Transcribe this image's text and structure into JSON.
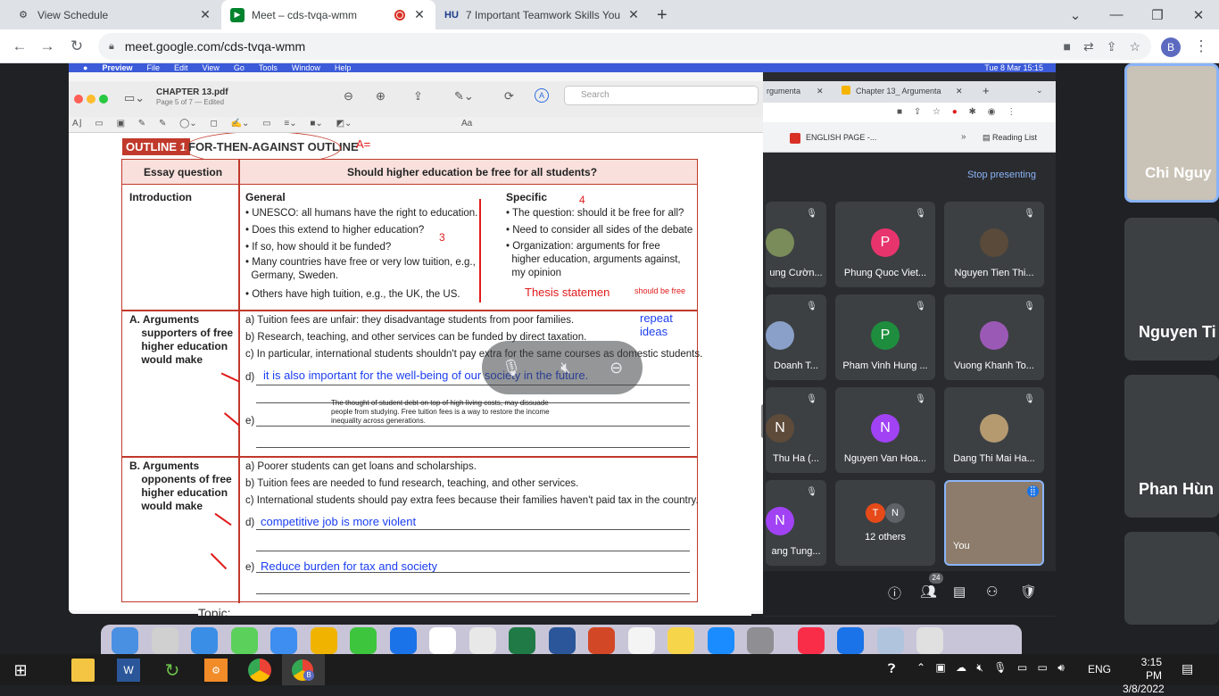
{
  "chrome": {
    "tabs": [
      {
        "title": "View Schedule",
        "icon": "schedule-icon",
        "active": false
      },
      {
        "title": "Meet – cds-tvqa-wmm",
        "icon": "meet-icon",
        "active": true,
        "recording": true
      },
      {
        "title": "7 Important Teamwork Skills You",
        "icon": "hu-icon",
        "icon_text": "HU",
        "active": false
      }
    ],
    "url": "meet.google.com/cds-tvqa-wmm",
    "profile_initial": "B"
  },
  "mac": {
    "menu": [
      "Preview",
      "File",
      "Edit",
      "View",
      "Go",
      "Tools",
      "Window",
      "Help"
    ],
    "datetime": "Tue 8 Mar  15:15"
  },
  "preview": {
    "filename": "CHAPTER 13.pdf",
    "subtitle": "Page 5 of 7 — Edited",
    "search_placeholder": "Search",
    "font_menu": "Aa"
  },
  "doc": {
    "outline_label": "OUTLINE 1",
    "outline_title": "FOR-THEN-AGAINST OUTLINE",
    "grade_mark": "A=",
    "essay_question_label": "Essay question",
    "essay_question": "Should higher education be free for all students?",
    "intro_label": "Introduction",
    "general_label": "General",
    "general_items": [
      "UNESCO: all humans have the right to education.",
      "Does this extend to higher education?",
      "If so, how should it be funded?",
      "Many countries have free or very low tuition, e.g.,",
      "Germany, Sweden.",
      "Others have high tuition, e.g., the UK, the US."
    ],
    "general_mark": "3",
    "specific_label": "Specific",
    "specific_mark": "4",
    "specific_items": [
      "The question: should it be free for all?",
      "Need to consider all sides of the debate",
      "Organization: arguments for free",
      "higher education, arguments against,",
      "my opinion"
    ],
    "thesis_note": "Thesis statemen",
    "thesis_note2": "should be free",
    "sectionA_label": [
      "A. Arguments",
      "supporters of free",
      "higher education",
      "would make"
    ],
    "sectionA_items": [
      "a) Tuition fees are unfair: they disadvantage students from poor families.",
      "b) Research, teaching, and other services can be funded by direct taxation.",
      "c) In particular, international students shouldn't pay extra for the same courses as domestic students."
    ],
    "repeat_note": "repeat ideas",
    "a_d_prefix": "d)",
    "a_d_text": "it is also important for the well-being of our society in the future.",
    "a_e_prefix": "e)",
    "a_e_text": [
      "The thought of student debt on top of high living costs, may dissuade",
      "people from studying. Free tuition fees is a way to restore the income",
      "inequality across generations."
    ],
    "sectionB_label": [
      "B. Arguments",
      "opponents of free",
      "higher education",
      "would make"
    ],
    "sectionB_items": [
      "a) Poorer students can get loans and scholarships.",
      "b) Tuition fees are needed to fund research, teaching, and other services.",
      "c) International students should pay extra fees because their families haven't paid tax in the country."
    ],
    "b_d_prefix": "d)",
    "b_d_text": "competitive job is more violent",
    "b_e_prefix": "e)",
    "b_e_text": "Reduce burden for tax and society",
    "topic_label": "Topic:"
  },
  "right_browser": {
    "tabs": [
      "rgumenta",
      "Chapter 13_ Argumenta"
    ],
    "bookmark": "ENGLISH PAGE -...",
    "reading_list": "Reading List"
  },
  "meet": {
    "stop_presenting": "Stop presenting",
    "pinned_name": "Chi Nguy",
    "participants": [
      {
        "name": "ung Cườn...",
        "initial": "",
        "color": "#7a8c5a"
      },
      {
        "name": "Phung Quoc Viet...",
        "initial": "P",
        "color": "#e8346d"
      },
      {
        "name": "Nguyen Tien Thi...",
        "initial": "",
        "color": "#5a4a3a"
      },
      {
        "name": "Doanh T...",
        "initial": "",
        "color": "#8aa0c8"
      },
      {
        "name": "Pham Vinh Hung ...",
        "initial": "P",
        "color": "#1e8e3e"
      },
      {
        "name": "Vuong Khanh To...",
        "initial": "",
        "color": "#9b59b6"
      },
      {
        "name": "Thu Ha (...",
        "initial": "N",
        "color": "#5f4b3a"
      },
      {
        "name": "Nguyen Van Hoa...",
        "initial": "N",
        "color": "#a142f4"
      },
      {
        "name": "Dang Thi Mai Ha...",
        "initial": "",
        "color": "#b59a70"
      },
      {
        "name": "ang Tung...",
        "initial": "N",
        "color": "#a142f4"
      },
      {
        "name": "12 others",
        "initial": "",
        "color": "#e64a19"
      },
      {
        "name": "You",
        "initial": "",
        "color": "#7a6a5a"
      }
    ],
    "others_initials": [
      "T",
      "N"
    ],
    "people_count": "24",
    "side_names": [
      "Nguyen Ti",
      "Phan Hùn"
    ]
  },
  "taskbar": {
    "lang": "ENG",
    "time": "3:15 PM",
    "date": "3/8/2022",
    "chrome_badge": "B"
  },
  "colors": {
    "red": "#c0392b",
    "blue_ink": "#1b3ef0",
    "meet_blue": "#8ab4f8"
  }
}
